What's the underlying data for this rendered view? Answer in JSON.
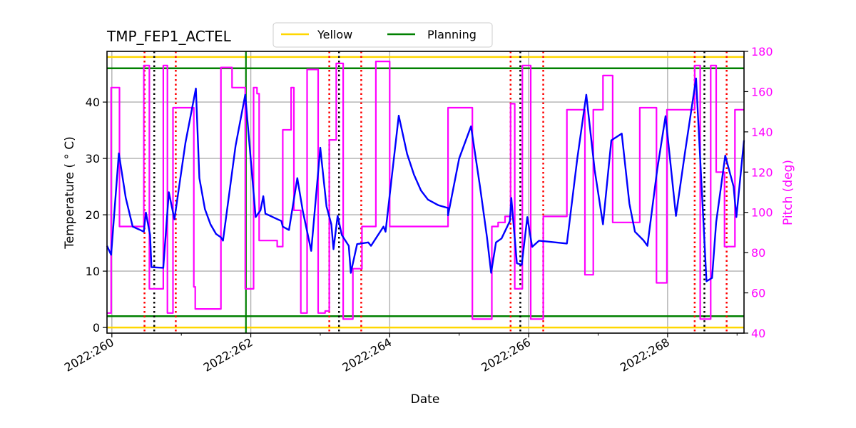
{
  "chart_data": {
    "type": "line",
    "title": "TMP_FEP1_ACTEL",
    "xlabel": "Date",
    "ylabel": "Temperature ($^\\circ$C)",
    "ylabel_display": "Temperature ( ° C)",
    "y2label": "Pitch (deg)",
    "xlim": [
      259.93,
      269.1
    ],
    "ylim": [
      -1,
      49
    ],
    "y2lim": [
      40,
      180
    ],
    "x_ticks": [
      {
        "value": 260,
        "label": "2022:260"
      },
      {
        "value": 262,
        "label": "2022:262"
      },
      {
        "value": 264,
        "label": "2022:264"
      },
      {
        "value": 266,
        "label": "2022:266"
      },
      {
        "value": 268,
        "label": "2022:268"
      }
    ],
    "x_minor_ticks": [
      261,
      263,
      265,
      267,
      269
    ],
    "y_ticks": [
      0,
      10,
      20,
      30,
      40
    ],
    "y2_ticks": [
      40,
      60,
      80,
      100,
      120,
      140,
      160,
      180
    ],
    "grid": true,
    "legend": {
      "placement": "top-center-outside",
      "entries": [
        {
          "label": "Yellow",
          "color": "#ffd700"
        },
        {
          "label": "Planning",
          "color": "#008000"
        }
      ]
    },
    "colors": {
      "temperature": "#0000ff",
      "pitch": "#ff00ff",
      "yellow": "#ffd700",
      "planning": "#008000",
      "red_dotted": "#ff0000",
      "black_dotted": "#000000",
      "grid": "#b0b0b0",
      "y2_axis": "#ff00ff"
    },
    "horizontal_limits": [
      {
        "name": "yellow-high",
        "value": 48,
        "color": "#ffd700"
      },
      {
        "name": "yellow-low",
        "value": 0,
        "color": "#ffd700"
      },
      {
        "name": "planning-high",
        "value": 46,
        "color": "#008000"
      },
      {
        "name": "planning-low",
        "value": 2,
        "color": "#008000"
      }
    ],
    "vertical_lines": {
      "planning_now": [
        261.93
      ],
      "red_dotted": [
        260.47,
        260.92,
        263.13,
        263.59,
        265.74,
        266.21,
        268.39,
        268.85
      ],
      "black_dotted": [
        260.61,
        263.27,
        265.88,
        268.53
      ]
    },
    "series": [
      {
        "name": "Temperature",
        "axis": "left",
        "color": "#0000ff",
        "points": [
          [
            259.93,
            14.5
          ],
          [
            259.99,
            12.9
          ],
          [
            260.1,
            30.9
          ],
          [
            260.2,
            23.0
          ],
          [
            260.3,
            17.9
          ],
          [
            260.39,
            17.4
          ],
          [
            260.46,
            17.0
          ],
          [
            260.49,
            20.4
          ],
          [
            260.55,
            16.4
          ],
          [
            260.57,
            10.7
          ],
          [
            260.74,
            10.6
          ],
          [
            260.82,
            24.0
          ],
          [
            260.9,
            19.2
          ],
          [
            261.06,
            32.8
          ],
          [
            261.21,
            42.4
          ],
          [
            261.26,
            26.5
          ],
          [
            261.34,
            21.0
          ],
          [
            261.42,
            18.3
          ],
          [
            261.5,
            16.6
          ],
          [
            261.57,
            16.0
          ],
          [
            261.6,
            15.4
          ],
          [
            261.78,
            32.2
          ],
          [
            261.92,
            41.3
          ],
          [
            262.07,
            19.6
          ],
          [
            262.14,
            20.8
          ],
          [
            262.18,
            23.3
          ],
          [
            262.21,
            20.2
          ],
          [
            262.44,
            18.9
          ],
          [
            262.46,
            17.9
          ],
          [
            262.55,
            17.3
          ],
          [
            262.67,
            26.5
          ],
          [
            262.75,
            20.6
          ],
          [
            262.87,
            13.6
          ],
          [
            263.0,
            31.9
          ],
          [
            263.09,
            21.5
          ],
          [
            263.16,
            18.3
          ],
          [
            263.19,
            13.9
          ],
          [
            263.25,
            19.8
          ],
          [
            263.31,
            16.4
          ],
          [
            263.41,
            14.5
          ],
          [
            263.44,
            9.7
          ],
          [
            263.53,
            14.8
          ],
          [
            263.69,
            15.1
          ],
          [
            263.73,
            14.5
          ],
          [
            263.91,
            17.9
          ],
          [
            263.94,
            17.0
          ],
          [
            264.13,
            37.6
          ],
          [
            264.25,
            30.8
          ],
          [
            264.35,
            27.1
          ],
          [
            264.45,
            24.3
          ],
          [
            264.55,
            22.7
          ],
          [
            264.7,
            21.7
          ],
          [
            264.84,
            21.2
          ],
          [
            264.84,
            19.9
          ],
          [
            265.0,
            30.0
          ],
          [
            265.17,
            35.7
          ],
          [
            265.3,
            25.0
          ],
          [
            265.4,
            16.0
          ],
          [
            265.46,
            9.7
          ],
          [
            265.53,
            15.1
          ],
          [
            265.61,
            15.8
          ],
          [
            265.73,
            18.9
          ],
          [
            265.75,
            23.0
          ],
          [
            265.83,
            11.4
          ],
          [
            265.9,
            11.1
          ],
          [
            265.98,
            19.6
          ],
          [
            266.05,
            14.3
          ],
          [
            266.15,
            15.4
          ],
          [
            266.55,
            14.9
          ],
          [
            266.7,
            30.0
          ],
          [
            266.83,
            41.3
          ],
          [
            266.95,
            28.0
          ],
          [
            267.07,
            18.3
          ],
          [
            267.19,
            33.2
          ],
          [
            267.34,
            34.4
          ],
          [
            267.45,
            22.0
          ],
          [
            267.53,
            17.0
          ],
          [
            267.65,
            15.5
          ],
          [
            267.71,
            14.5
          ],
          [
            267.85,
            28.0
          ],
          [
            267.97,
            37.5
          ],
          [
            268.12,
            19.8
          ],
          [
            268.25,
            31.0
          ],
          [
            268.41,
            44.2
          ],
          [
            268.56,
            8.2
          ],
          [
            268.64,
            8.8
          ],
          [
            268.7,
            18.7
          ],
          [
            268.83,
            30.5
          ],
          [
            268.95,
            25.0
          ],
          [
            268.99,
            19.6
          ],
          [
            269.1,
            33.2
          ]
        ]
      },
      {
        "name": "Pitch",
        "axis": "right",
        "color": "#ff00ff",
        "step_points": [
          [
            259.93,
            50
          ],
          [
            259.99,
            50
          ],
          [
            259.99,
            162
          ],
          [
            260.11,
            162
          ],
          [
            260.11,
            93
          ],
          [
            260.46,
            93
          ],
          [
            260.46,
            173
          ],
          [
            260.54,
            173
          ],
          [
            260.54,
            62
          ],
          [
            260.74,
            62
          ],
          [
            260.74,
            173
          ],
          [
            260.8,
            173
          ],
          [
            260.8,
            50
          ],
          [
            260.88,
            50
          ],
          [
            260.88,
            152
          ],
          [
            261.18,
            152
          ],
          [
            261.18,
            63
          ],
          [
            261.2,
            63
          ],
          [
            261.2,
            52
          ],
          [
            261.57,
            52
          ],
          [
            261.57,
            172
          ],
          [
            261.73,
            172
          ],
          [
            261.73,
            162
          ],
          [
            261.92,
            162
          ],
          [
            261.92,
            62
          ],
          [
            262.04,
            62
          ],
          [
            262.04,
            162
          ],
          [
            262.09,
            162
          ],
          [
            262.09,
            159
          ],
          [
            262.12,
            159
          ],
          [
            262.12,
            86
          ],
          [
            262.38,
            86
          ],
          [
            262.38,
            83
          ],
          [
            262.46,
            83
          ],
          [
            262.46,
            141
          ],
          [
            262.58,
            141
          ],
          [
            262.58,
            162
          ],
          [
            262.62,
            162
          ],
          [
            262.62,
            101
          ],
          [
            262.72,
            101
          ],
          [
            262.72,
            50
          ],
          [
            262.81,
            50
          ],
          [
            262.81,
            171
          ],
          [
            262.97,
            171
          ],
          [
            262.97,
            50
          ],
          [
            263.07,
            50
          ],
          [
            263.07,
            51
          ],
          [
            263.13,
            51
          ],
          [
            263.13,
            136
          ],
          [
            263.23,
            136
          ],
          [
            263.23,
            174
          ],
          [
            263.33,
            174
          ],
          [
            263.33,
            47
          ],
          [
            263.47,
            47
          ],
          [
            263.47,
            72
          ],
          [
            263.6,
            72
          ],
          [
            263.6,
            93
          ],
          [
            263.8,
            93
          ],
          [
            263.8,
            175
          ],
          [
            264.0,
            175
          ],
          [
            264.0,
            93
          ],
          [
            264.84,
            93
          ],
          [
            264.84,
            152
          ],
          [
            265.19,
            152
          ],
          [
            265.19,
            47
          ],
          [
            265.47,
            47
          ],
          [
            265.47,
            93
          ],
          [
            265.56,
            93
          ],
          [
            265.56,
            95
          ],
          [
            265.66,
            95
          ],
          [
            265.66,
            98
          ],
          [
            265.74,
            98
          ],
          [
            265.74,
            154
          ],
          [
            265.8,
            154
          ],
          [
            265.8,
            62
          ],
          [
            265.91,
            62
          ],
          [
            265.91,
            173
          ],
          [
            266.03,
            173
          ],
          [
            266.03,
            47
          ],
          [
            266.21,
            47
          ],
          [
            266.21,
            98
          ],
          [
            266.55,
            98
          ],
          [
            266.55,
            151
          ],
          [
            266.81,
            151
          ],
          [
            266.81,
            69
          ],
          [
            266.93,
            69
          ],
          [
            266.93,
            151
          ],
          [
            267.07,
            151
          ],
          [
            267.07,
            168
          ],
          [
            267.21,
            168
          ],
          [
            267.21,
            95
          ],
          [
            267.6,
            95
          ],
          [
            267.6,
            152
          ],
          [
            267.84,
            152
          ],
          [
            267.84,
            65
          ],
          [
            267.99,
            65
          ],
          [
            267.99,
            151
          ],
          [
            268.39,
            151
          ],
          [
            268.39,
            173
          ],
          [
            268.47,
            173
          ],
          [
            268.47,
            47
          ],
          [
            268.62,
            47
          ],
          [
            268.62,
            173
          ],
          [
            268.7,
            173
          ],
          [
            268.7,
            120
          ],
          [
            268.82,
            120
          ],
          [
            268.82,
            83
          ],
          [
            268.97,
            83
          ],
          [
            268.97,
            151
          ],
          [
            269.1,
            151
          ]
        ]
      }
    ]
  }
}
